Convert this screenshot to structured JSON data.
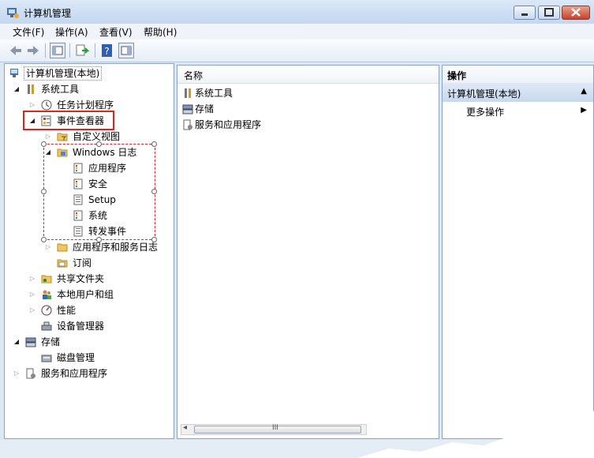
{
  "window": {
    "title": "计算机管理"
  },
  "menu": {
    "file": "文件(F)",
    "action": "操作(A)",
    "view": "查看(V)",
    "help": "帮助(H)"
  },
  "tree": {
    "root": "计算机管理(本地)",
    "system_tools": "系统工具",
    "task_scheduler": "任务计划程序",
    "event_viewer": "事件查看器",
    "custom_views": "自定义视图",
    "windows_logs": "Windows 日志",
    "application": "应用程序",
    "security": "安全",
    "setup": "Setup",
    "system": "系统",
    "forwarded": "转发事件",
    "app_service_logs": "应用程序和服务日志",
    "subscriptions": "订阅",
    "shared_folders": "共享文件夹",
    "local_users": "本地用户和组",
    "performance": "性能",
    "device_manager": "设备管理器",
    "storage": "存储",
    "disk_management": "磁盘管理",
    "services_apps": "服务和应用程序"
  },
  "list": {
    "column_name": "名称",
    "items": [
      "系统工具",
      "存储",
      "服务和应用程序"
    ],
    "scroll_grip": "III"
  },
  "actions": {
    "title": "操作",
    "section": "计算机管理(本地)",
    "more": "更多操作"
  },
  "colors": {
    "highlight_border": "#d9271f",
    "pane_border": "#8ea3be"
  }
}
